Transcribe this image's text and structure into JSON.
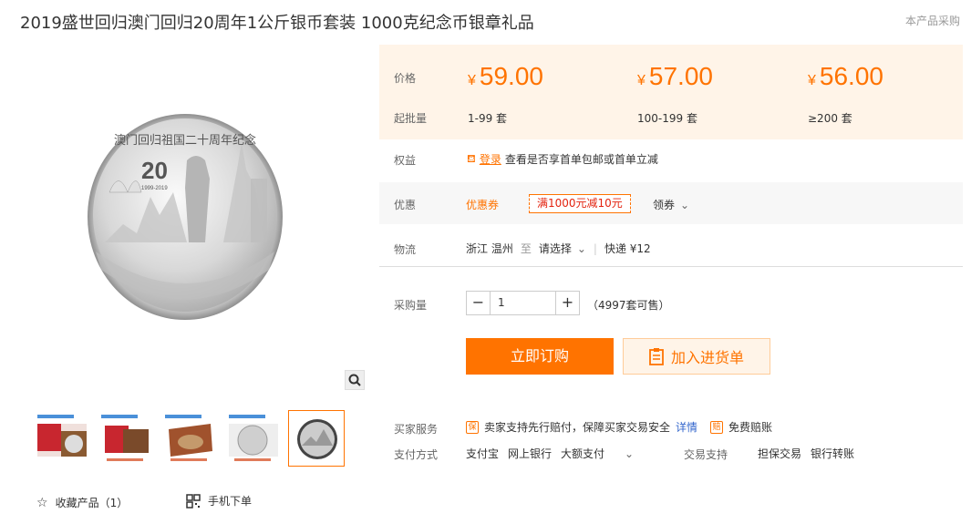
{
  "title": "2019盛世回归澳门回归20周年1公斤银币套装 1000克纪念币银章礼品",
  "top_right_link": "本产品采购",
  "pricing": {
    "price_label": "价格",
    "moq_label": "起批量",
    "tiers": [
      {
        "currency": "¥",
        "price": "59.00",
        "range": "1-99 套"
      },
      {
        "currency": "¥",
        "price": "57.00",
        "range": "100-199 套"
      },
      {
        "currency": "¥",
        "price": "56.00",
        "range": "≥200 套"
      }
    ]
  },
  "benefits": {
    "label": "权益",
    "login_link": "登录",
    "text": "查看是否享首单包邮或首单立减"
  },
  "promotion": {
    "label": "优惠",
    "coupon_label": "优惠券",
    "coupon": "满1000元减10元",
    "claim": "领券"
  },
  "logistics": {
    "label": "物流",
    "origin": "浙江 温州",
    "to": "至",
    "destination": "请选择",
    "shipping": "快递 ¥12"
  },
  "purchase": {
    "label": "采购量",
    "quantity": "1",
    "stock": "（4997套可售）",
    "buy_now": "立即订购",
    "add_to_cart": "加入进货单"
  },
  "services": {
    "buyer_label": "买家服务",
    "guarantee": "卖家支持先行赔付，保障买家交易安全",
    "details": "详情",
    "free_compensation": "免费赔账",
    "payment_label": "支付方式",
    "payment_methods": [
      "支付宝",
      "网上银行",
      "大额支付"
    ],
    "trade_label": "交易支持",
    "trade_methods": [
      "担保交易",
      "银行转账"
    ]
  },
  "gallery": {
    "coin_text": "澳门回归祖国二十周年纪念",
    "coin_years": "1999-2019"
  },
  "actions": {
    "favorite": "收藏产品（1）",
    "mobile_order": "手机下单"
  },
  "colors": {
    "accent": "#ff7300",
    "price_bg": "#fff4e8",
    "coupon_red": "#e3230f"
  }
}
